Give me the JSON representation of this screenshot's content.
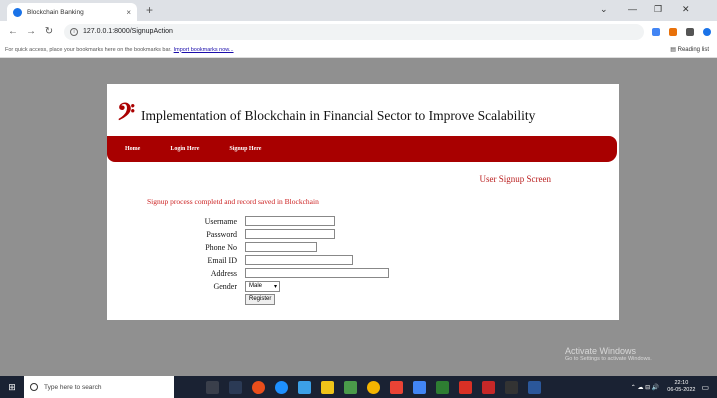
{
  "browser": {
    "tab_title": "Blockchain Banking",
    "tab_close": "×",
    "new_tab": "+",
    "url": "127.0.0.1:8000/SignupAction",
    "bookmarks_text": "For quick access, place your bookmarks here on the bookmarks bar.",
    "bookmarks_link": "Import bookmarks now...",
    "reading_list": "Reading list",
    "win_minimize": "—",
    "win_maximize": "❐",
    "win_close": "✕",
    "win_chevron": "⌄"
  },
  "site": {
    "logo_glyph": "𝄢",
    "title": "Implementation of Blockchain in Financial Sector to Improve Scalability",
    "nav": [
      "Home",
      "Login Here",
      "Signup Here"
    ],
    "brand_color": "#a80000"
  },
  "form": {
    "screen_title": "User Signup Screen",
    "status_message": "Signup process completd and record saved in Blockchain",
    "labels": {
      "username": "Username",
      "password": "Password",
      "phone": "Phone No",
      "email": "Email ID",
      "address": "Address",
      "gender": "Gender"
    },
    "gender_value": "Male",
    "register_label": "Register"
  },
  "watermark": {
    "title": "Activate Windows",
    "subtitle": "Go to Settings to activate Windows."
  },
  "taskbar": {
    "search_placeholder": "Type here to search",
    "time": "22:10",
    "date": "06-05-2022"
  }
}
